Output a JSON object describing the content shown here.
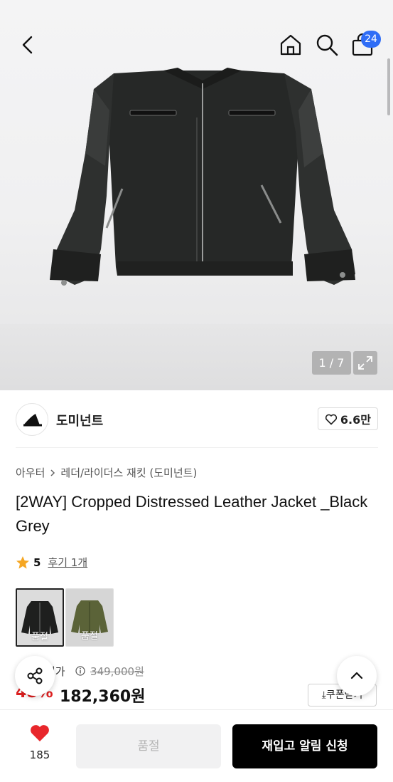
{
  "header": {
    "cart_count": "24"
  },
  "gallery": {
    "pager": "1 / 7"
  },
  "brand": {
    "name": "도미넌트",
    "likes": "6.6만"
  },
  "breadcrumb": {
    "category": "아우터",
    "subcategory": "레더/라이더스 재킷 (도미넌트)"
  },
  "product": {
    "title": "[2WAY] Cropped Distressed Leather Jacket _Black Grey",
    "rating": "5",
    "review_label": "후기 1개",
    "swatches": [
      {
        "color": "#1e1f1e",
        "status": "품절"
      },
      {
        "color": "#5b6338",
        "status": "품절"
      }
    ]
  },
  "price": {
    "original_label": "정가",
    "original": "349,000원",
    "discount": "48%",
    "sale": "182,360원",
    "coupon_label": "쿠폰받기"
  },
  "bottom_bar": {
    "wish_count": "185",
    "soldout_label": "품절",
    "restock_label": "재입고 알림 신청"
  },
  "colors": {
    "accent_red": "#e02020",
    "badge_blue": "#2f6df6",
    "heart_red": "#e8262b"
  }
}
